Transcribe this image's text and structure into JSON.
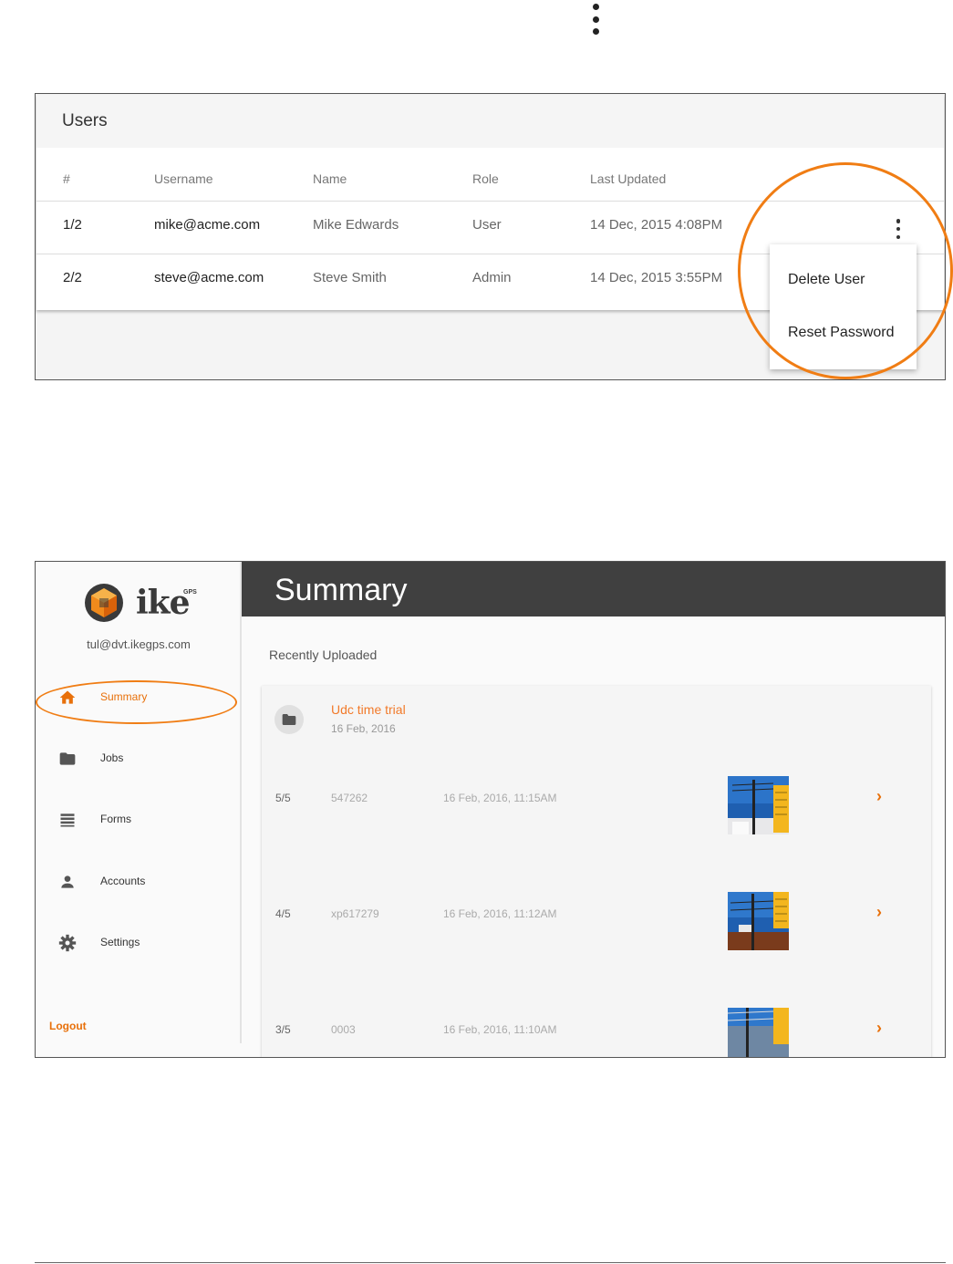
{
  "users_panel": {
    "title": "Users",
    "columns": [
      "#",
      "Username",
      "Name",
      "Role",
      "Last Updated"
    ],
    "rows": [
      {
        "index": "1/2",
        "username": "mike@acme.com",
        "name": "Mike Edwards",
        "role": "User",
        "last_updated": "14 Dec, 2015 4:08PM"
      },
      {
        "index": "2/2",
        "username": "steve@acme.com",
        "name": "Steve Smith",
        "role": "Admin",
        "last_updated": "14 Dec, 2015 3:55PM"
      }
    ],
    "menu": {
      "delete_label": "Delete User",
      "reset_label": "Reset Password"
    },
    "highlight_color": "#f07d14"
  },
  "app": {
    "logo_text": "ike",
    "logo_superscript": "GPS",
    "user_email": "tul@dvt.ikegps.com",
    "nav": [
      {
        "label": "Summary",
        "icon": "home-icon",
        "active": true
      },
      {
        "label": "Jobs",
        "icon": "folder-icon",
        "active": false
      },
      {
        "label": "Forms",
        "icon": "forms-icon",
        "active": false
      },
      {
        "label": "Accounts",
        "icon": "person-icon",
        "active": false
      },
      {
        "label": "Settings",
        "icon": "gear-icon",
        "active": false
      }
    ],
    "logout_label": "Logout",
    "header_title": "Summary",
    "section_label": "Recently Uploaded",
    "job": {
      "title": "Udc time trial",
      "date": "16 Feb, 2016",
      "entries": [
        {
          "index": "5/5",
          "id": "547262",
          "date": "16 Feb, 2016, 11:15AM",
          "chevron": "›"
        },
        {
          "index": "4/5",
          "id": "xp617279",
          "date": "16 Feb, 2016, 11:12AM",
          "chevron": "›"
        },
        {
          "index": "3/5",
          "id": "0003",
          "date": "16 Feb, 2016, 11:10AM",
          "chevron": "›"
        }
      ]
    },
    "accent_color": "#e8700a",
    "header_color": "#404040"
  }
}
